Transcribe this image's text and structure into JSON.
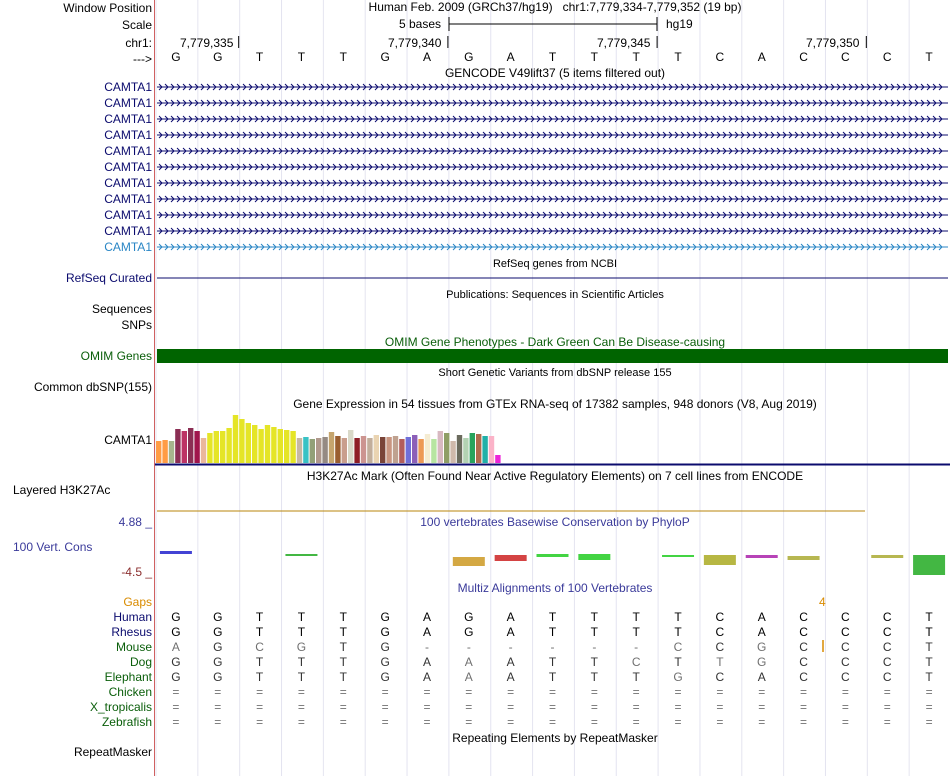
{
  "header": {
    "window_position_label": "Window Position",
    "scale_label": "Scale",
    "chr_label": "chr1:",
    "strand_label": "--->",
    "assembly_text": "Human Feb. 2009 (GRCh37/hg19)",
    "position_text": "chr1:7,779,334-7,779,352 (19 bp)",
    "scale_text": "5 bases",
    "db_text": "hg19",
    "coordinates": [
      "7,779,335",
      "7,779,340",
      "7,779,345",
      "7,779,350"
    ]
  },
  "sequence": [
    "G",
    "G",
    "T",
    "T",
    "T",
    "G",
    "A",
    "G",
    "A",
    "T",
    "T",
    "T",
    "T",
    "C",
    "A",
    "C",
    "C",
    "C",
    "T"
  ],
  "tracks": {
    "gencode": {
      "title": "GENCODE V49lift37 (5 items filtered out)",
      "genes": [
        "CAMTA1",
        "CAMTA1",
        "CAMTA1",
        "CAMTA1",
        "CAMTA1",
        "CAMTA1",
        "CAMTA1",
        "CAMTA1",
        "CAMTA1",
        "CAMTA1",
        "CAMTA1"
      ],
      "color": "#0b0b6e",
      "last_color": "#2a86c5"
    },
    "refseq": {
      "label": "RefSeq Curated",
      "title": "RefSeq genes from NCBI",
      "color": "#0b0b6e"
    },
    "publications": {
      "title": "Publications: Sequences in Scientific Articles",
      "label1": "Sequences",
      "label2": "SNPs"
    },
    "omim": {
      "label": "OMIM Genes",
      "title": "OMIM Gene Phenotypes - Dark Green Can Be Disease-causing",
      "color": "#006400"
    },
    "dbsnp": {
      "label": "Common dbSNP(155)",
      "title": "Short Genetic Variants from dbSNP release 155"
    },
    "gtex": {
      "title": "Gene Expression in 54 tissues from GTEx RNA-seq of 17382 samples, 948 donors (V8, Aug 2019)",
      "label": "CAMTA1",
      "values": [
        22,
        23,
        22,
        34,
        32,
        35,
        32,
        25,
        30,
        32,
        32,
        35,
        48,
        44,
        40,
        38,
        34,
        38,
        36,
        34,
        33,
        32,
        25,
        26,
        24,
        25,
        26,
        31,
        27,
        25,
        33,
        25,
        27,
        25,
        28,
        26,
        26,
        27,
        24,
        26,
        28,
        24,
        29,
        24,
        32,
        30,
        22,
        28,
        25,
        30,
        29,
        27,
        27,
        8
      ],
      "colors": [
        "#ff9c45",
        "#ff9c45",
        "#a6b58d",
        "#8b2e54",
        "#bd3365",
        "#8b2e54",
        "#a0154c",
        "#eab79b",
        "#e5e527",
        "#e5e527",
        "#e5e527",
        "#e5e527",
        "#e5e527",
        "#e5e527",
        "#e5e527",
        "#e5e527",
        "#e5e527",
        "#e5e527",
        "#e5e527",
        "#e5e527",
        "#e5e527",
        "#e5e527",
        "#c7b8a4",
        "#39c2c5",
        "#92a078",
        "#b0988c",
        "#958a83",
        "#c6a56e",
        "#9a5e30",
        "#c99e8d",
        "#d9d9c8",
        "#8e1e26",
        "#cc9490",
        "#c2ae9b",
        "#ead4b2",
        "#7a4438",
        "#c99580",
        "#bfa18f",
        "#b25d5a",
        "#6f6fd8",
        "#8c5fb8",
        "#ed9955",
        "#f5ecd2",
        "#b7e5a1",
        "#d8b9c1",
        "#8f9e66",
        "#cfb9ab",
        "#6b6b5d",
        "#b3d2b3",
        "#28a35c",
        "#b06b4d",
        "#21b0a8",
        "#fbb3c8",
        "#ec24d8"
      ]
    },
    "h3k27ac": {
      "label": "Layered H3K27Ac",
      "title": "H3K27Ac Mark (Often Found Near Active Regulatory Elements) on 7 cell lines from ENCODE"
    },
    "conservation": {
      "label": "100 Vert. Cons",
      "title": "100 vertebrates Basewise Conservation by PhyloP",
      "max": "4.88 _",
      "min": "-4.5 _"
    },
    "multiz": {
      "title": "Multiz Alignments of 100 Vertebrates",
      "gaps_label": "Gaps",
      "gap_count": "4",
      "species": [
        {
          "name": "Human",
          "bases": [
            "G",
            "G",
            "T",
            "T",
            "T",
            "G",
            "A",
            "G",
            "A",
            "T",
            "T",
            "T",
            "T",
            "C",
            "A",
            "C",
            "C",
            "C",
            "T"
          ]
        },
        {
          "name": "Rhesus",
          "bases": [
            "G",
            "G",
            "T",
            "T",
            "T",
            "G",
            "A",
            "G",
            "A",
            "T",
            "T",
            "T",
            "T",
            "C",
            "A",
            "C",
            "C",
            "C",
            "T"
          ]
        },
        {
          "name": "Mouse",
          "bases": [
            "A",
            "G",
            "C",
            "G",
            "T",
            "G",
            "-",
            "-",
            "-",
            "-",
            "-",
            "-",
            "C",
            "C",
            "G",
            "C",
            "C",
            "C",
            "T"
          ]
        },
        {
          "name": "Dog",
          "bases": [
            "G",
            "G",
            "T",
            "T",
            "T",
            "G",
            "A",
            "A",
            "A",
            "T",
            "T",
            "C",
            "T",
            "T",
            "G",
            "C",
            "C",
            "C",
            "T"
          ]
        },
        {
          "name": "Elephant",
          "bases": [
            "G",
            "G",
            "T",
            "T",
            "T",
            "G",
            "A",
            "A",
            "A",
            "T",
            "T",
            "T",
            "G",
            "C",
            "A",
            "C",
            "C",
            "C",
            "T"
          ]
        },
        {
          "name": "Chicken",
          "bases": [
            "=",
            "=",
            "=",
            "=",
            "=",
            "=",
            "=",
            "=",
            "=",
            "=",
            "=",
            "=",
            "=",
            "=",
            "=",
            "=",
            "=",
            "=",
            "="
          ]
        },
        {
          "name": "X_tropicalis",
          "bases": [
            "=",
            "=",
            "=",
            "=",
            "=",
            "=",
            "=",
            "=",
            "=",
            "=",
            "=",
            "=",
            "=",
            "=",
            "=",
            "=",
            "=",
            "=",
            "="
          ]
        },
        {
          "name": "Zebrafish",
          "bases": [
            "=",
            "=",
            "=",
            "=",
            "=",
            "=",
            "=",
            "=",
            "=",
            "=",
            "=",
            "=",
            "=",
            "=",
            "=",
            "=",
            "=",
            "=",
            "="
          ]
        }
      ]
    },
    "repeatmasker": {
      "label": "RepeatMasker",
      "title": "Repeating Elements by RepeatMasker"
    }
  },
  "colors": {
    "navy": "#0b0b6e",
    "green": "#0a5e0a",
    "conservation": "#3a3a9a",
    "gaps": "#d98b00",
    "label_border": "#d06060"
  }
}
